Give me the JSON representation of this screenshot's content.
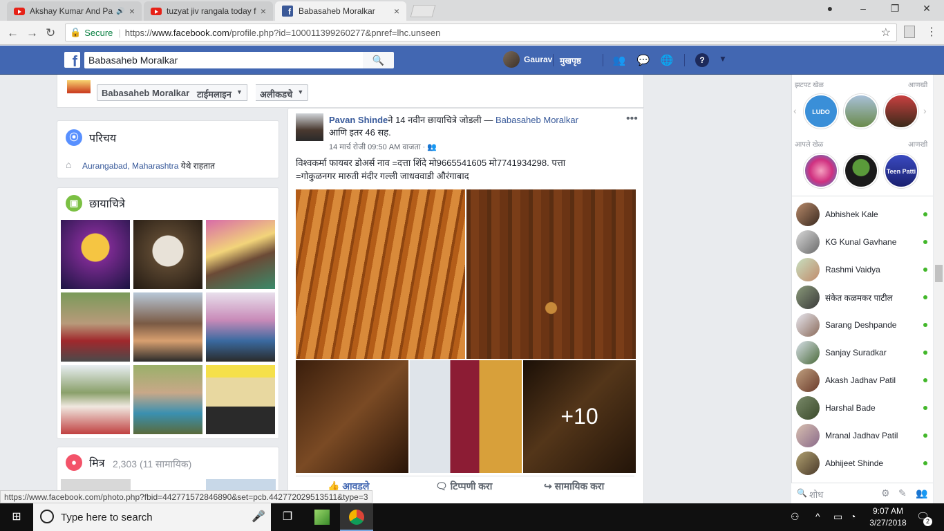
{
  "browser": {
    "tabs": [
      {
        "title": "Akshay Kumar And Pa",
        "icon": "youtube-icon",
        "audio": "🔊"
      },
      {
        "title": "tuzyat jiv rangala today f",
        "icon": "youtube-icon"
      },
      {
        "title": "Babasaheb Moralkar",
        "icon": "facebook-icon"
      }
    ],
    "secure_label": "Secure",
    "url_prefix": "https://",
    "url_domain": "www.facebook.com",
    "url_rest": "/profile.php?id=100011399260277&pnref=lhc.unseen",
    "status_url": "https://www.facebook.com/photo.php?fbid=442771572846890&set=pcb.442772029513511&type=3"
  },
  "fb_header": {
    "search_value": "Babasaheb Moralkar",
    "user_name": "Gaurav",
    "home_label": "मुखपृष्ठ"
  },
  "profile_nav": {
    "name": "Babasaheb Moralkar",
    "timeline_label": "टाईमलाइन",
    "recent_label": "अलीकडचे"
  },
  "intro": {
    "title": "परिचय",
    "location_link": "Aurangabad, Maharashtra",
    "location_suffix": " येथे राहतात"
  },
  "photos": {
    "title": "छायाचित्रे"
  },
  "friends": {
    "title": "मित्र",
    "count": "2,303",
    "mutual": "(11 सामायिक)"
  },
  "post": {
    "author": "Pavan Shinde",
    "action_text": "ने 14 नवीन छायाचित्रे जोडली — ",
    "tagged": "Babasaheb Moralkar",
    "others": "आणि इतर 46 सह.",
    "timestamp": "14 मार्च रोजी 09:50 AM वाजता",
    "body_line1": "विश्वकर्मा फायबर डोअर्स नाव =दत्ता शिंदे मो9665541605 मो7741934298. पत्ता",
    "body_line2": "=गोकुळनगर मारुती मंदीर गल्ली जाधववाडी औरंगाबाद",
    "more_photos": "+10",
    "like_label": "आवडले",
    "comment_label": "टिप्पणी करा",
    "share_label": "सामायिक करा"
  },
  "sidebar": {
    "quick_games": "झटपट खेळ",
    "your_games": "आपले खेळ",
    "more": "आणखी",
    "ludo_label": "LUDO CLUB",
    "teen_label": "Teen Patti",
    "search_placeholder": "शोध",
    "contacts": [
      {
        "name": "Abhishek Kale"
      },
      {
        "name": "KG Kunal Gavhane"
      },
      {
        "name": "Rashmi Vaidya"
      },
      {
        "name": "संकेत कळमकर पाटील"
      },
      {
        "name": "Sarang Deshpande"
      },
      {
        "name": "Sanjay Suradkar"
      },
      {
        "name": "Akash Jadhav Patil"
      },
      {
        "name": "Harshal Bade"
      },
      {
        "name": "Mranal Jadhav Patil"
      },
      {
        "name": "Abhijeet Shinde"
      }
    ]
  },
  "taskbar": {
    "search_text": "Type here to search",
    "time": "9:07 AM",
    "date": "3/27/2018",
    "notif_count": "2"
  }
}
